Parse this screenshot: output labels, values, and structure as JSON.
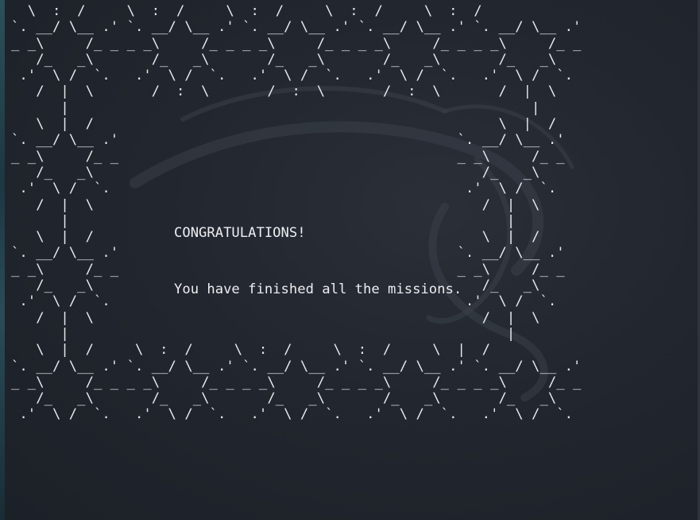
{
  "terminal": {
    "ascii_border": "  \\  :  /     \\  :  /     \\  :  /     \\  :  /     \\  :  /\n`. __/ \\__ .' `. __/ \\__ .' `. __/ \\__ .' `. __/ \\__ .' `. __/ \\__ .'\n_ _\\     /_ _ _ _\\     /_ _ _ _\\     /_ _ _ _\\     /_ _ _ _\\     /_ _\n   /_   _\\       /_   _\\       /_   _\\       /_   _\\       /_   _\\\n .'  \\ /  `.   .'  \\ /  `.   .'  \\ /  `.   .'  \\ /  `.   .'  \\ /  `.\n   /  |  \\       /  :  \\       /  :  \\       /  :  \\       /  |  \\\n      |                                                        |\n   \\  |  /                                                 \\  |  /\n`. __/ \\__ .'                                         `. __/ \\__ .'\n_ _\\     /_ _                                         _ _\\     /_ _\n   /_   _\\                                               /_   _\\\n .'  \\ /  `.                                           .'  \\ /  `.\n   /  |  \\                                               /  |  \\\n      |                                                     |\n   \\  |  /                                               \\  |  /\n`. __/ \\__ .'                                         `. __/ \\__ .'\n_ _\\     /_ _                                         _ _\\     /_ _\n   /_   _\\                                               /_   _\\\n .'  \\ /  `.                                           .'  \\ /  `.\n   /  |  \\                                               /  |  \\\n      |                                                     |\n   \\  |  /     \\  :  /     \\  :  /     \\  :  /     \\  |  /\n`. __/ \\__ .' `. __/ \\__ .' `. __/ \\__ .' `. __/ \\__ .' `. __/ \\__ .'\n_ _\\     /_ _ _ _\\     /_ _ _ _\\     /_ _ _ _\\     /_ _ _ _\\     /_ _\n   /_   _\\       /_   _\\       /_   _\\       /_   _\\       /_   _\\\n .'  \\ /  `.   .'  \\ /  `.   .'  \\ /  `.   .'  \\ /  `.   .'  \\ /  `.",
    "congratulations": "CONGRATULATIONS!",
    "finished_message": "You have finished all the missions."
  },
  "colors": {
    "background": "#22262e",
    "text": "#e6e8ec",
    "left_edge_accent": "#2b5a64"
  }
}
